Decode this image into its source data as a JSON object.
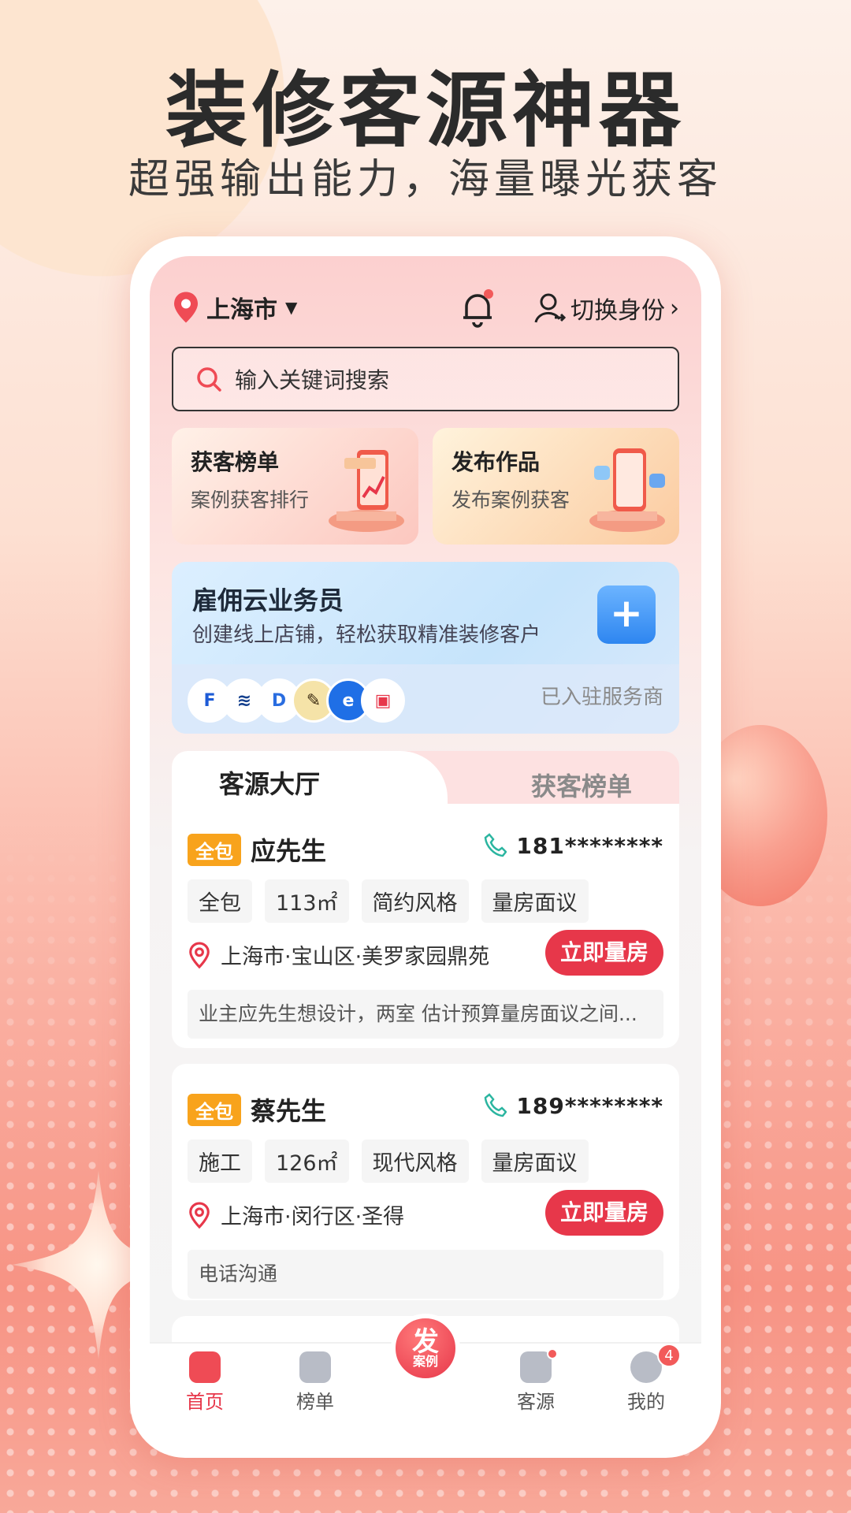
{
  "promo": {
    "headline": "装修客源神器",
    "subline": "超强输出能力，海量曝光获客"
  },
  "header": {
    "city": "上海市",
    "switch_identity": "切换身份"
  },
  "search": {
    "placeholder": "输入关键词搜索"
  },
  "feature_cards": [
    {
      "title": "获客榜单",
      "subtitle": "案例获客排行"
    },
    {
      "title": "发布作品",
      "subtitle": "发布案例获客"
    }
  ],
  "hire_banner": {
    "title": "雇佣云业务员",
    "subtitle": "创建线上店铺，轻松获取精准装修客户",
    "joined_label": "已入驻服务商"
  },
  "tabs": {
    "active": "客源大厅",
    "inactive": "获客榜单"
  },
  "leads": [
    {
      "badge": "全包",
      "name": "应先生",
      "phone": "181********",
      "tags": [
        "全包",
        "113㎡",
        "简约风格",
        "量房面议"
      ],
      "address": "上海市·宝山区·美罗家园鼎苑",
      "action": "立即量房",
      "note": "业主应先生想设计，两室 估计预算量房面议之间..."
    },
    {
      "badge": "全包",
      "name": "蔡先生",
      "phone": "189********",
      "tags": [
        "施工",
        "126㎡",
        "现代风格",
        "量房面议"
      ],
      "address": "上海市·闵行区·圣得",
      "action": "立即量房",
      "note": "电话沟通"
    }
  ],
  "tabbar": {
    "items": [
      {
        "label": "首页",
        "icon": "home-icon"
      },
      {
        "label": "榜单",
        "icon": "ranking-icon"
      },
      {
        "label": "发",
        "sub": "案例",
        "icon": "publish-icon"
      },
      {
        "label": "客源",
        "icon": "leads-icon"
      },
      {
        "label": "我的",
        "icon": "profile-icon",
        "badge": "4"
      }
    ]
  },
  "colors": {
    "accent": "#e7374a",
    "badge": "#f8a31c",
    "phone_icon": "#2bb5a0"
  }
}
